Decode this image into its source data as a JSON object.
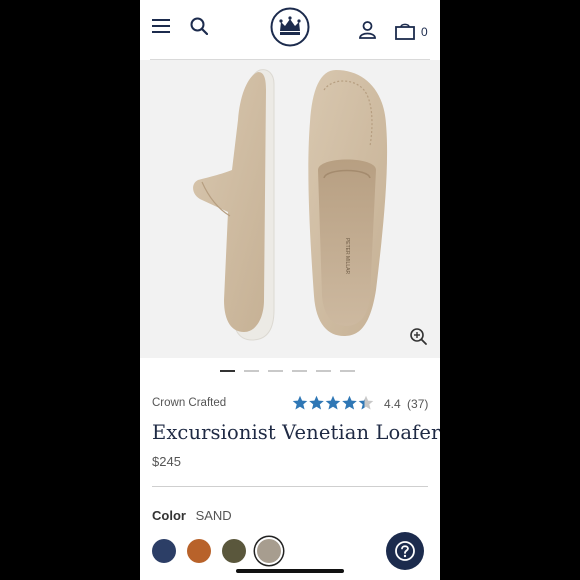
{
  "header": {
    "cart_count": "0",
    "icons": [
      "menu-icon",
      "search-icon",
      "crown-logo",
      "account-icon",
      "cart-icon"
    ]
  },
  "gallery": {
    "slide_count": 6,
    "active_slide": 1,
    "zoom_icon": "zoom-in-icon",
    "printed_insole_text": "PETER MILLAR"
  },
  "product": {
    "collection": "Crown Crafted",
    "rating_value": "4.4",
    "rating_count": "(37)",
    "rating_stars": 4.4,
    "title": "Excursionist Venetian Loafer",
    "price": "$245"
  },
  "color": {
    "label": "Color",
    "selected": "SAND",
    "swatches": [
      {
        "name": "navy",
        "hex": "#2c3e66"
      },
      {
        "name": "cognac",
        "hex": "#b8622a"
      },
      {
        "name": "olive",
        "hex": "#5a573c"
      },
      {
        "name": "sand",
        "hex": "#a79d8f",
        "selected": true
      }
    ]
  },
  "colors": {
    "brand_navy": "#1c2b4d",
    "star_blue": "#2f77b5",
    "star_empty": "#c8c8c8"
  },
  "help_icon": "help-question-icon"
}
